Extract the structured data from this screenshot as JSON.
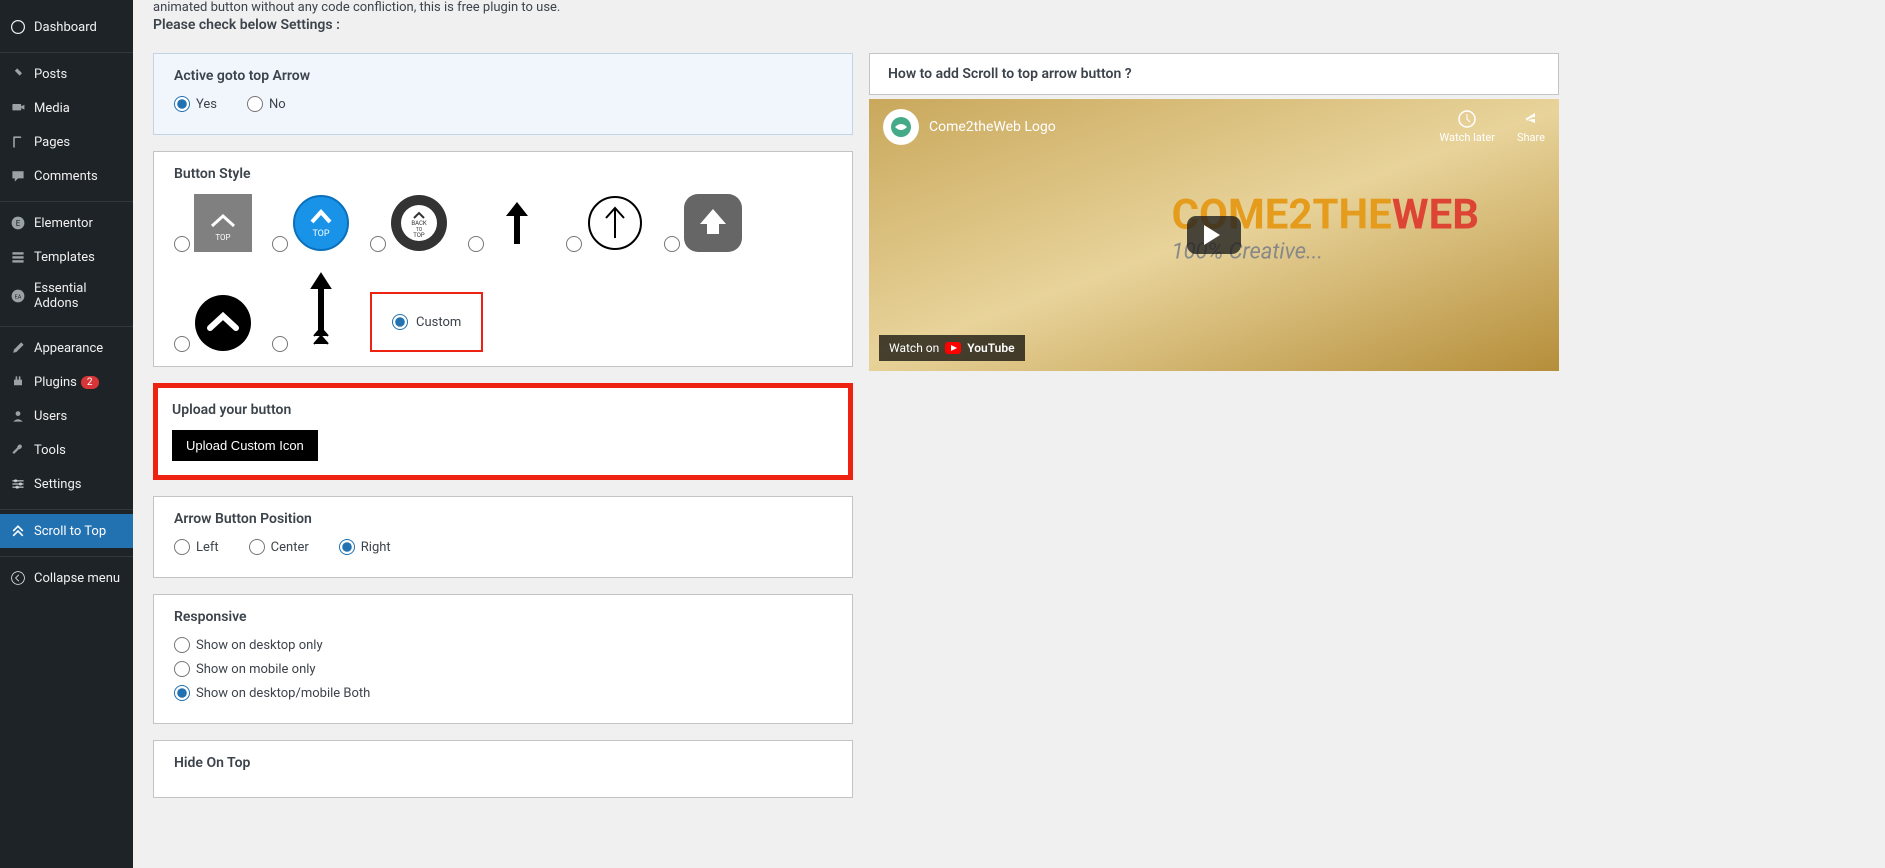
{
  "sidebar": {
    "items": [
      {
        "label": "Dashboard"
      },
      {
        "label": "Posts"
      },
      {
        "label": "Media"
      },
      {
        "label": "Pages"
      },
      {
        "label": "Comments"
      },
      {
        "label": "Elementor"
      },
      {
        "label": "Templates"
      },
      {
        "label": "Essential Addons"
      },
      {
        "label": "Appearance"
      },
      {
        "label": "Plugins",
        "badge": "2"
      },
      {
        "label": "Users"
      },
      {
        "label": "Tools"
      },
      {
        "label": "Settings"
      },
      {
        "label": "Scroll to Top"
      },
      {
        "label": "Collapse menu"
      }
    ]
  },
  "intro": {
    "line": "animated button without any code confliction, this is free plugin to use.",
    "title": "Please check below Settings :"
  },
  "sections": {
    "active": {
      "title": "Active goto top Arrow",
      "yes": "Yes",
      "no": "No"
    },
    "style": {
      "title": "Button Style",
      "custom": "Custom"
    },
    "upload": {
      "title": "Upload your button",
      "btn": "Upload Custom Icon"
    },
    "position": {
      "title": "Arrow Button Position",
      "left": "Left",
      "center": "Center",
      "right": "Right"
    },
    "responsive": {
      "title": "Responsive",
      "desktop": "Show on desktop only",
      "mobile": "Show on mobile only",
      "both": "Show on desktop/mobile Both"
    },
    "hide": {
      "title": "Hide On Top"
    }
  },
  "video": {
    "panelTitle": "How to add Scroll to top arrow button ?",
    "title": "Come2theWeb Logo",
    "watchLater": "Watch later",
    "share": "Share",
    "brand1": "COME2THE",
    "brand2": "WEB",
    "sub": "100% Creative...",
    "footer": "Watch on",
    "youtube": "YouTube"
  }
}
